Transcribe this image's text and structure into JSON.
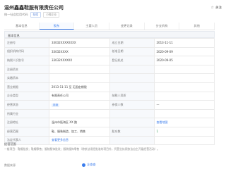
{
  "header": {
    "title": "温州鑫鑫鞋服有限责任公司",
    "subtitle": "统一社会信用代码",
    "tags": [
      "存续",
      "小微企业"
    ],
    "follow_label": "关注"
  },
  "tabs": [
    {
      "label": "基本信息",
      "active": false
    },
    {
      "label": "股东",
      "active": true
    },
    {
      "label": "主要人员",
      "active": false
    },
    {
      "label": "变更记录",
      "active": false
    },
    {
      "label": "分支机构",
      "active": false
    },
    {
      "label": "其他",
      "active": false
    }
  ],
  "section_title": "基本信息",
  "rows": [
    {
      "l1": "注册号",
      "v1": "33032XXXXXXXX",
      "l2": "成立日期",
      "v2": "2013-11-11"
    },
    {
      "l1": "组织机构代码",
      "v1": "33032XXXX",
      "l2": "核准日期",
      "v2": "2020-09-09"
    },
    {
      "l1": "纳税人识别号",
      "v1": "33032XXXXXX",
      "l2": "登记机关",
      "v2": "2020-09-05"
    },
    {
      "l1": "注册资本",
      "v1": "",
      "l2": "",
      "v2": ""
    },
    {
      "l1": "实缴资本",
      "v1": "",
      "l2": "",
      "v2": ""
    },
    {
      "l1": "营业期限",
      "v1": "2013-11-11 至 无固定期限",
      "l2": "",
      "v2": ""
    },
    {
      "l1": "企业类型",
      "v1": "有限责任公司",
      "l2": "纳税人资质",
      "v2": ""
    },
    {
      "l1": "经营状态",
      "v1": "存续",
      "l2": "参保人数",
      "v2": "—"
    },
    {
      "l1": "所属行业",
      "v1": "",
      "l2": "",
      "v2": ""
    },
    {
      "l1": "注册地址",
      "v1": "温州市瓯海区 XX 路",
      "l2": "",
      "v2": "查看地图"
    },
    {
      "l1": "经营范围",
      "v1": "鞋、服装制造、加工、销售",
      "l2": "股东数",
      "v2": "1"
    },
    {
      "l1": "法定代表人",
      "v1": "查看更多信息",
      "l2": "",
      "v2": ""
    }
  ],
  "section2": {
    "title": "经营范围",
    "text": "一般项目：鞋帽批发；鞋帽零售；服装服饰批发；服装服饰零售（除依法须经批准的项目外，凭营业执照依法自主开展经营活动）。"
  },
  "footer": {
    "left": "数据来源",
    "brand": "企查查"
  },
  "colors": {
    "accent": "#3a7cec",
    "label_bg": "#f7f9fc"
  }
}
